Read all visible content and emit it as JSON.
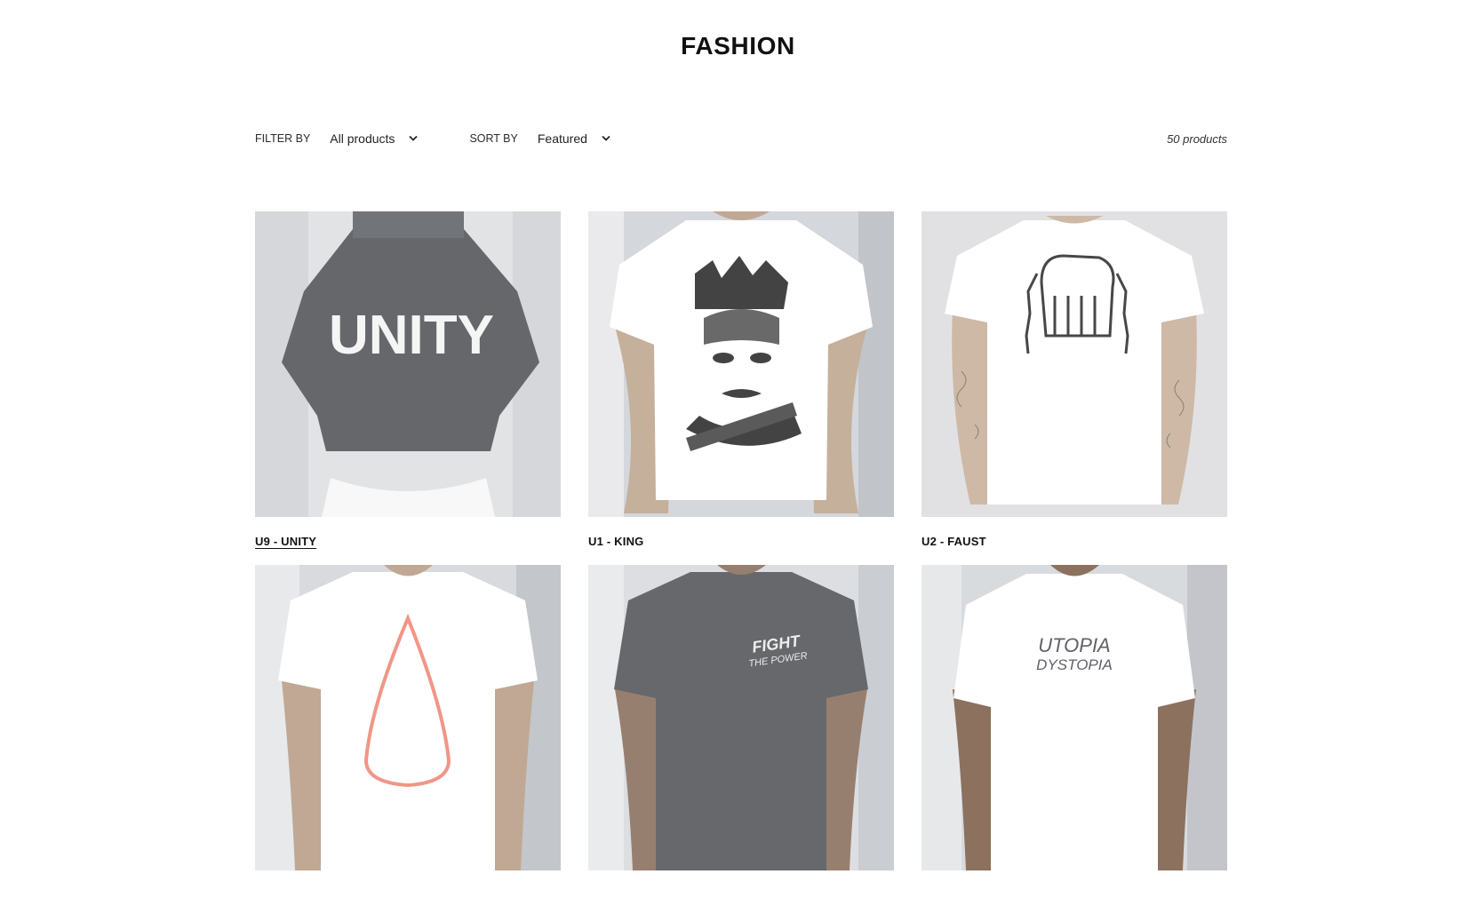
{
  "page": {
    "title": "FASHION"
  },
  "toolbar": {
    "filter_label": "FILTER BY",
    "filter_value": "All products",
    "sort_label": "SORT BY",
    "sort_value": "Featured",
    "count": "50 products",
    "chevron_icon": "chevron-down-icon"
  },
  "products": [
    {
      "name": "U9 - UNITY",
      "print": "UNITY",
      "shirt_color": "#2e3136"
    },
    {
      "name": "U1 - KING",
      "print": "portrait sketch",
      "shirt_color": "#ffffff"
    },
    {
      "name": "U2 - FAUST",
      "print": "fist with chains",
      "shirt_color": "#ffffff"
    },
    {
      "name": "",
      "print": "drop outline",
      "shirt_color": "#ffffff",
      "accent": "#f08a7a"
    },
    {
      "name": "",
      "print": "FIGHT THE POWER",
      "shirt_color": "#2a2d31"
    },
    {
      "name": "",
      "print": "UTOPIA DYSTOPIA",
      "shirt_color": "#ffffff"
    }
  ]
}
